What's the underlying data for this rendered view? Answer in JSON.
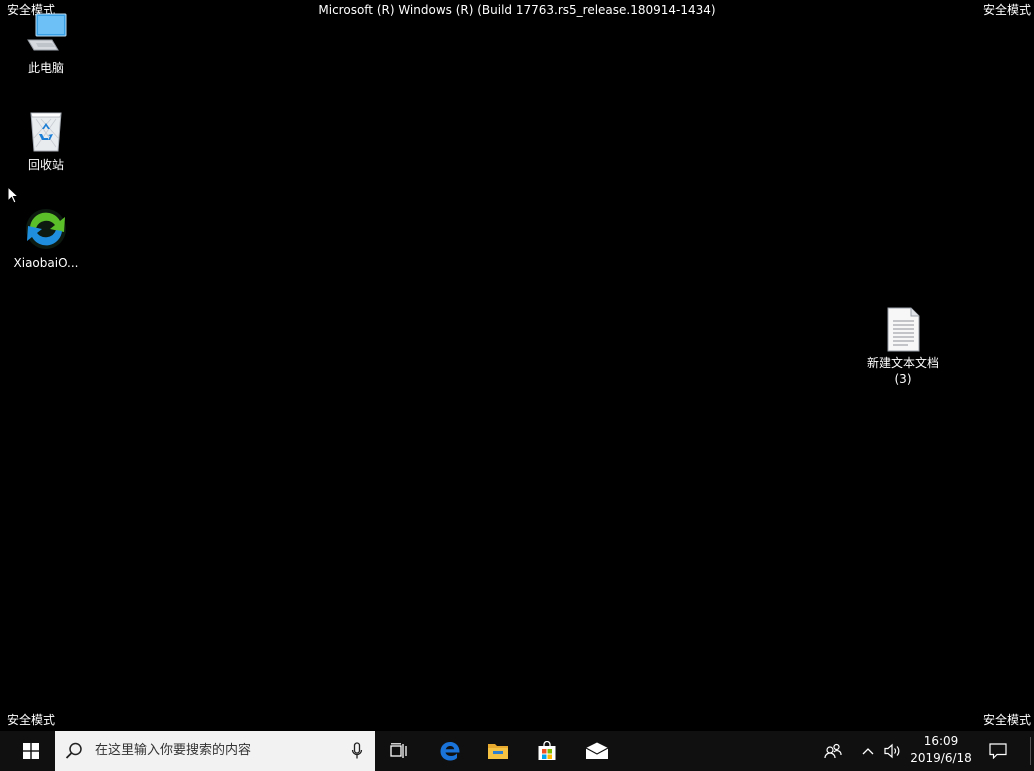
{
  "overlay": {
    "safe_mode_label": "安全模式",
    "build_string": "Microsoft (R) Windows (R) (Build 17763.rs5_release.180914-1434)"
  },
  "desktop": {
    "icons": [
      {
        "label": "此电脑",
        "icon": "this-pc-icon"
      },
      {
        "label": "回收站",
        "icon": "recycle-bin-icon"
      },
      {
        "label": "XiaobaiO...",
        "icon": "xiaobai-app-icon"
      },
      {
        "label": "新建文本文档",
        "label2": "(3)",
        "icon": "text-document-icon"
      }
    ]
  },
  "taskbar": {
    "search_placeholder": "在这里输入你要搜索的内容",
    "pinned": [
      "task-view-icon",
      "edge-icon",
      "file-explorer-icon",
      "store-icon",
      "mail-icon"
    ],
    "clock_time": "16:09",
    "clock_date": "2019/6/18"
  },
  "colors": {
    "desktop_background": "#000000",
    "taskbar_background": "#101010",
    "search_background": "#f2f2f2",
    "edge_blue": "#1a73d8",
    "folder_yellow": "#f5c242"
  }
}
